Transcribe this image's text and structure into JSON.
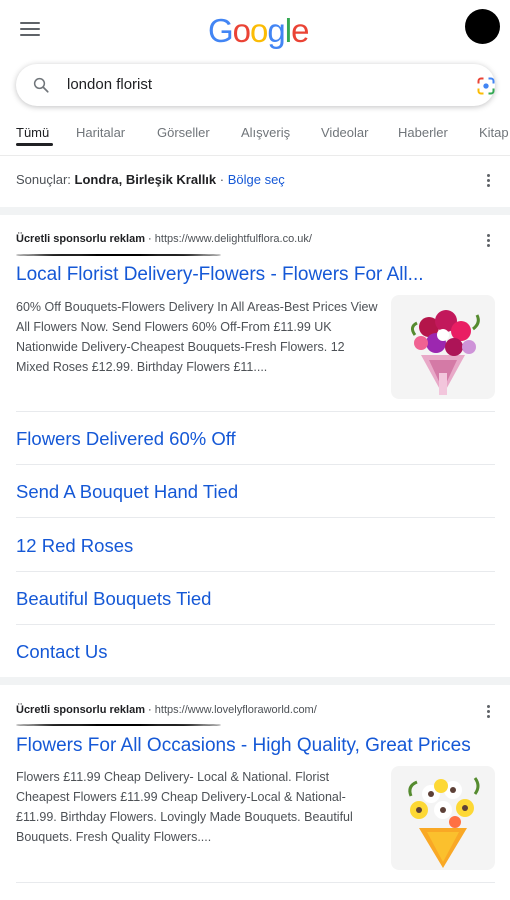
{
  "header": {
    "logo": {
      "G": "G",
      "o1": "o",
      "o2": "o",
      "g": "g",
      "l": "l",
      "e": "e"
    }
  },
  "search": {
    "query": "london florist"
  },
  "tabs": [
    "Tümü",
    "Haritalar",
    "Görseller",
    "Alışveriş",
    "Videolar",
    "Haberler",
    "Kitap"
  ],
  "region": {
    "prefix": "Sonuçlar: ",
    "location": "Londra, Birleşik Krallık",
    "separator": " · ",
    "change_link": "Bölge seç"
  },
  "ads": [
    {
      "label": "Ücretli sponsorlu reklam",
      "dot": " · ",
      "url": "https://www.delightfulflora.co.uk/",
      "title": "Local Florist Delivery-Flowers - Flowers For All...",
      "description": "60% Off Bouquets-Flowers Delivery In All Areas-Best Prices View All Flowers Now. Send Flowers 60% Off-From £11.99 UK Nationwide Delivery-Cheapest Bouquets-Fresh Flowers. 12 Mixed Roses £12.99. Birthday Flowers £11....",
      "sitelinks": [
        "Flowers Delivered 60% Off",
        "Send A Bouquet Hand Tied",
        "12 Red Roses",
        "Beautiful Bouquets Tied",
        "Contact Us"
      ]
    },
    {
      "label": "Ücretli sponsorlu reklam",
      "dot": " · ",
      "url": "https://www.lovelyfloraworld.com/",
      "title": "Flowers For All Occasions - High Quality, Great Prices",
      "description": "Flowers £11.99 Cheap Delivery- Local & National. Florist Cheapest Flowers £11.99 Cheap Delivery-Local & National- £11.99. Birthday Flowers. Lovingly Made Bouquets. Beautiful Bouquets. Fresh Quality Flowers...."
    }
  ],
  "colors": {
    "link": "#1558d6",
    "text": "#202124",
    "muted": "#4d5156"
  }
}
